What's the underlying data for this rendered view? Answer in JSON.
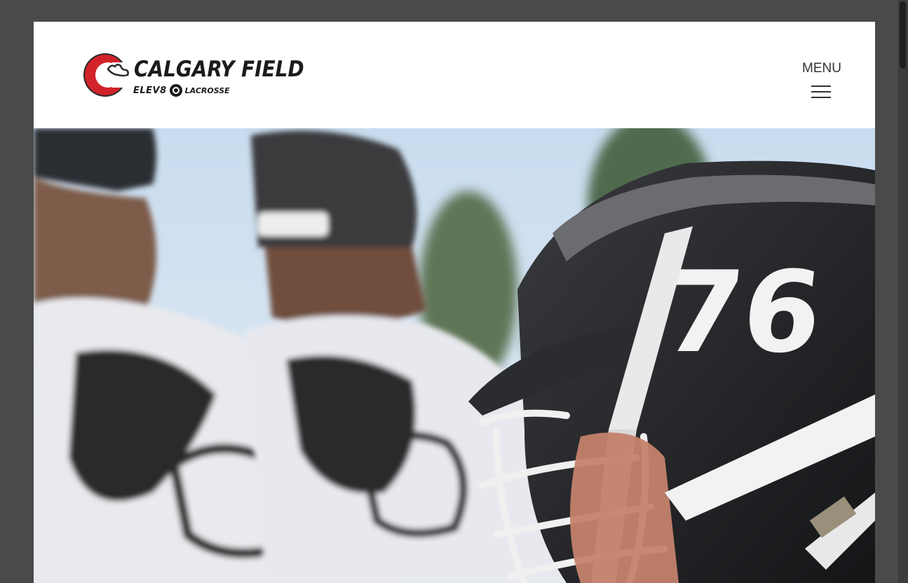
{
  "brand": {
    "name_main": "CALGARY FIELD",
    "name_sub_left": "ELEV8",
    "name_sub_right": "LACROSSE",
    "accent_color": "#d2232a"
  },
  "nav": {
    "menu_label": "MENU",
    "menu_icon": "hamburger-icon"
  },
  "hero": {
    "jersey_number": "76"
  }
}
